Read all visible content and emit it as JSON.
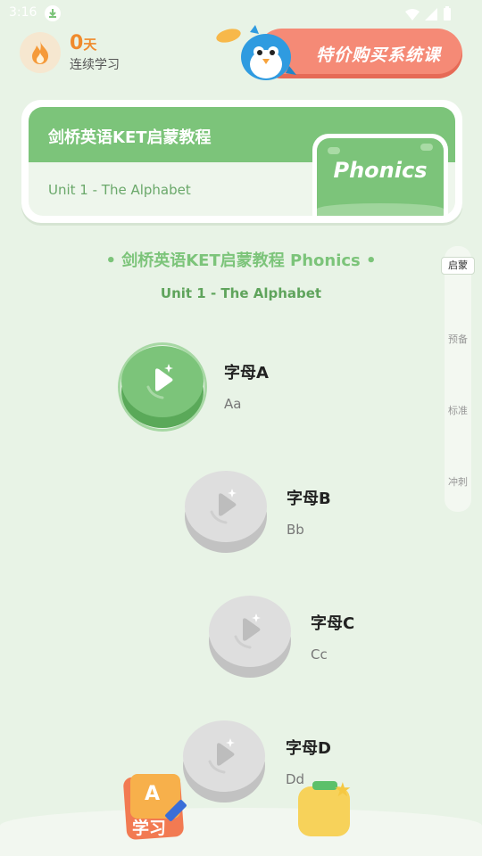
{
  "status_bar": {
    "time": "3:16"
  },
  "streak": {
    "count": "0",
    "unit": "天",
    "label": "连续学习"
  },
  "promo": {
    "label": "特价购买系统课"
  },
  "course_card": {
    "title": "剑桥英语KET启蒙教程",
    "unit": "Unit 1 - The Alphabet",
    "badge": "Phonics"
  },
  "section": {
    "title": "• 剑桥英语KET启蒙教程 Phonics •",
    "subtitle": "Unit 1 - The Alphabet"
  },
  "levels": {
    "active": "启蒙",
    "items": [
      "预备",
      "标准",
      "冲刺"
    ]
  },
  "lessons": [
    {
      "title": "字母A",
      "sub": "Aa",
      "state": "active"
    },
    {
      "title": "字母B",
      "sub": "Bb",
      "state": "locked"
    },
    {
      "title": "字母C",
      "sub": "Cc",
      "state": "locked"
    },
    {
      "title": "字母D",
      "sub": "Dd",
      "state": "locked"
    }
  ],
  "bottom_nav": {
    "study_label": "学习",
    "study_letter": "A"
  },
  "colors": {
    "background": "#e8f3e6",
    "accent_green": "#7cc47a",
    "promo": "#f58a76",
    "streak": "#f08a2c"
  },
  "icons": [
    "download-icon",
    "wifi-icon",
    "signal-icon",
    "battery-icon",
    "flame-icon",
    "play-icon",
    "sparkle-icon",
    "study-cards-icon",
    "bag-icon"
  ]
}
